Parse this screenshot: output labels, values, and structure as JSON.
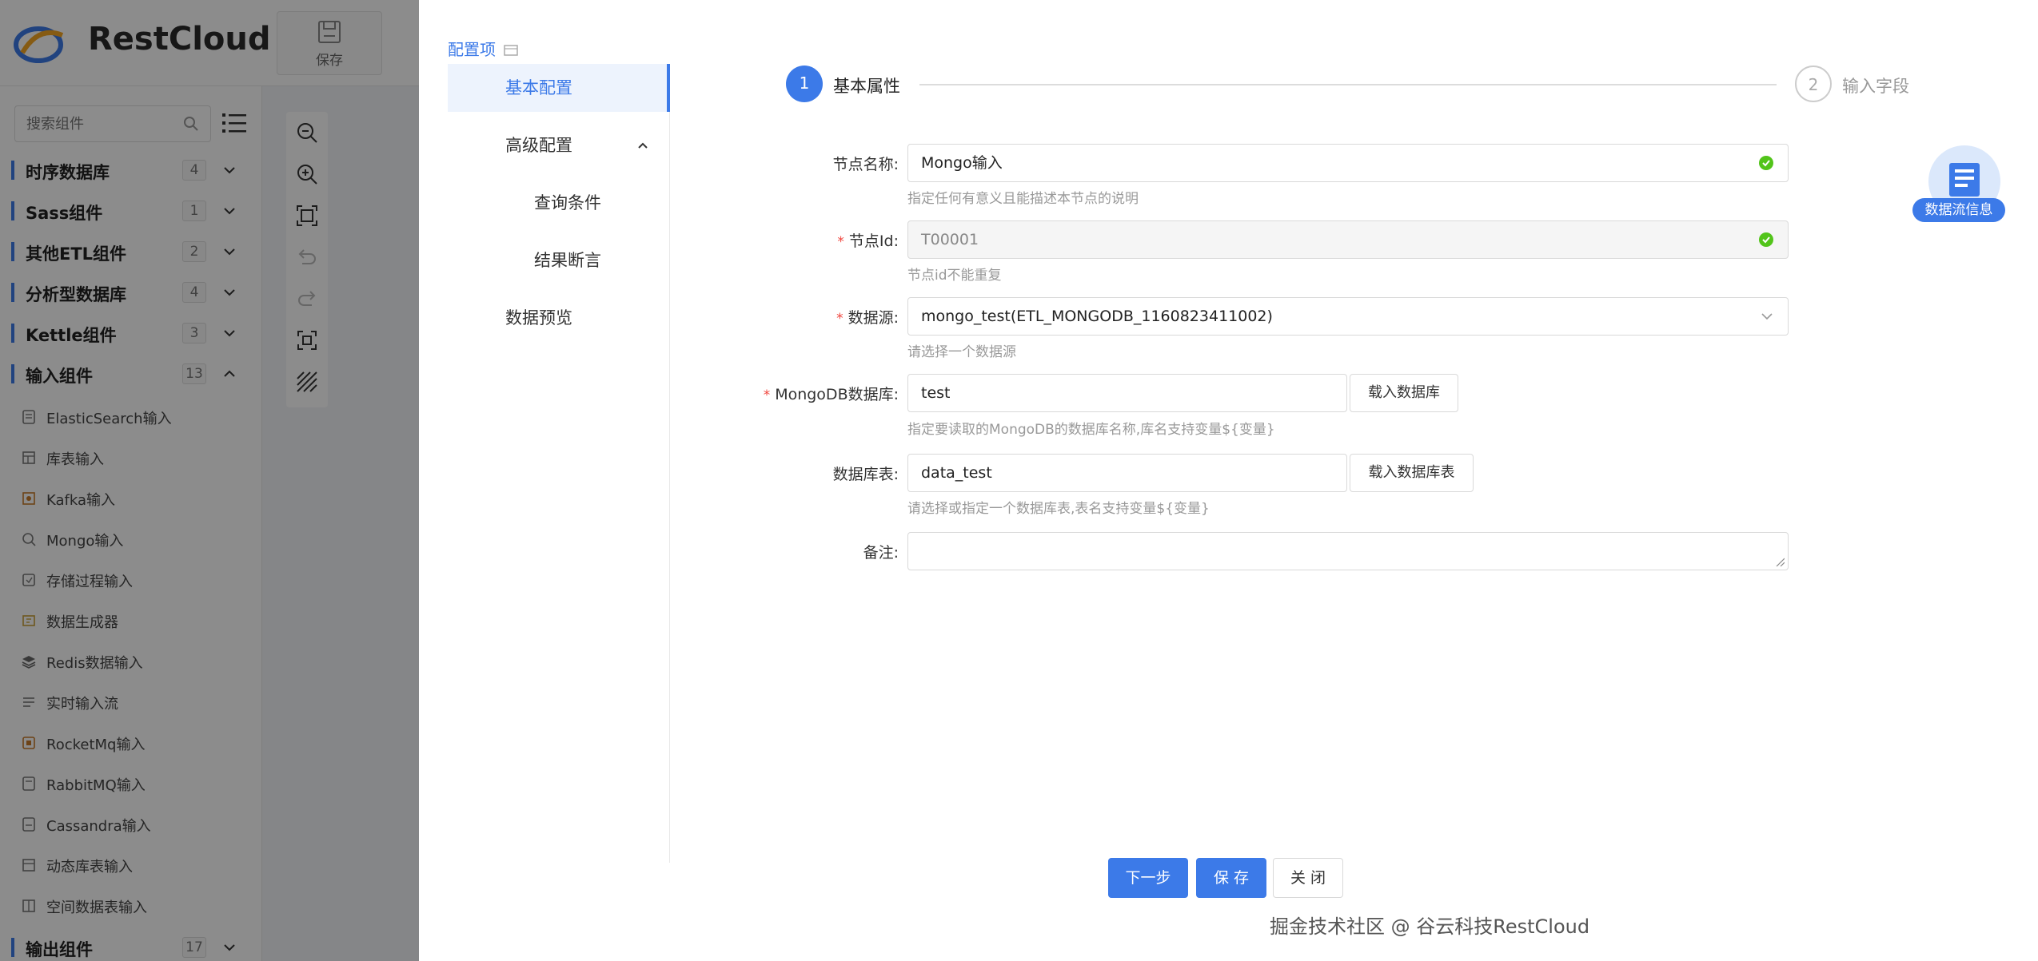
{
  "header": {
    "logo_text": "RestCloud",
    "save_label": "保存"
  },
  "sidebar": {
    "search_placeholder": "搜索组件",
    "groups": [
      {
        "label": "时序数据库",
        "count": "4"
      },
      {
        "label": "Sass组件",
        "count": "1"
      },
      {
        "label": "其他ETL组件",
        "count": "2"
      },
      {
        "label": "分析型数据库",
        "count": "4"
      },
      {
        "label": "Kettle组件",
        "count": "3"
      },
      {
        "label": "输入组件",
        "count": "13"
      },
      {
        "label": "输出组件",
        "count": "17"
      }
    ],
    "items": [
      {
        "label": "ElasticSearch输入",
        "icon": "elasticsearch-icon"
      },
      {
        "label": "库表输入",
        "icon": "table-icon"
      },
      {
        "label": "Kafka输入",
        "icon": "kafka-icon"
      },
      {
        "label": "Mongo输入",
        "icon": "mongo-icon"
      },
      {
        "label": "存储过程输入",
        "icon": "procedure-icon"
      },
      {
        "label": "数据生成器",
        "icon": "generator-icon"
      },
      {
        "label": "Redis数据输入",
        "icon": "redis-icon"
      },
      {
        "label": "实时输入流",
        "icon": "stream-icon"
      },
      {
        "label": "RocketMq输入",
        "icon": "rocketmq-icon"
      },
      {
        "label": "RabbitMQ输入",
        "icon": "rabbitmq-icon"
      },
      {
        "label": "Cassandra输入",
        "icon": "cassandra-icon"
      },
      {
        "label": "动态库表输入",
        "icon": "dynamic-table-icon"
      },
      {
        "label": "空间数据表输入",
        "icon": "spatial-table-icon"
      }
    ]
  },
  "drawer": {
    "config_title": "配置项",
    "menu": [
      {
        "label": "基本配置"
      },
      {
        "label": "高级配置"
      },
      {
        "label": "查询条件"
      },
      {
        "label": "结果断言"
      },
      {
        "label": "数据预览"
      }
    ],
    "steps": [
      {
        "num": "1",
        "label": "基本属性"
      },
      {
        "num": "2",
        "label": "输入字段"
      }
    ],
    "form": {
      "node_name": {
        "label": "节点名称:",
        "value": "Mongo输入",
        "hint": "指定任何有意义且能描述本节点的说明"
      },
      "node_id": {
        "label": "节点Id:",
        "value": "T00001",
        "hint": "节点id不能重复"
      },
      "datasource": {
        "label": "数据源:",
        "value": "mongo_test(ETL_MONGODB_1160823411002)",
        "hint": "请选择一个数据源"
      },
      "mongodb_db": {
        "label": "MongoDB数据库:",
        "value": "test",
        "button": "载入数据库",
        "hint": "指定要读取的MongoDB的数据库名称,库名支持变量${变量}"
      },
      "db_table": {
        "label": "数据库表:",
        "value": "data_test",
        "button": "载入数据库表",
        "hint": "请选择或指定一个数据库表,表名支持变量${变量}"
      },
      "remark": {
        "label": "备注:",
        "value": ""
      }
    },
    "flow_info_label": "数据流信息",
    "buttons": {
      "next": "下一步",
      "save": "保 存",
      "close": "关 闭"
    },
    "required_mark": "*"
  },
  "footer": {
    "watermark": "掘金技术社区 @ 谷云科技RestCloud"
  },
  "colors": {
    "accent": "#3c7ae8",
    "success": "#52c41a",
    "required": "#f0443c"
  }
}
